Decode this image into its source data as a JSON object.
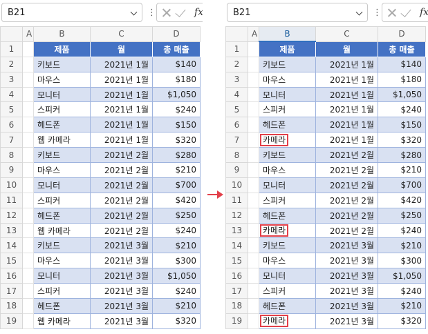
{
  "columns": [
    "",
    "A",
    "B",
    "C",
    "D"
  ],
  "left": {
    "namebox": "B21",
    "header": {
      "b": "제품",
      "c": "월",
      "d": "총 매출"
    },
    "rows": [
      {
        "n": "1"
      },
      {
        "n": "2",
        "b": "키보드",
        "c": "2021년 1월",
        "d": "$140"
      },
      {
        "n": "3",
        "b": "마우스",
        "c": "2021년 1월",
        "d": "$180"
      },
      {
        "n": "4",
        "b": "모니터",
        "c": "2021년 1월",
        "d": "$1,050"
      },
      {
        "n": "5",
        "b": "스피커",
        "c": "2021년 1월",
        "d": "$240"
      },
      {
        "n": "6",
        "b": "헤드폰",
        "c": "2021년 1월",
        "d": "$150"
      },
      {
        "n": "7",
        "b": "웹 카메라",
        "c": "2021년 1월",
        "d": "$320"
      },
      {
        "n": "8",
        "b": "키보드",
        "c": "2021년 2월",
        "d": "$280"
      },
      {
        "n": "9",
        "b": "마우스",
        "c": "2021년 2월",
        "d": "$210"
      },
      {
        "n": "10",
        "b": "모니터",
        "c": "2021년 2월",
        "d": "$700"
      },
      {
        "n": "11",
        "b": "스피커",
        "c": "2021년 2월",
        "d": "$420"
      },
      {
        "n": "12",
        "b": "헤드폰",
        "c": "2021년 2월",
        "d": "$250"
      },
      {
        "n": "13",
        "b": "웹 카메라",
        "c": "2021년 2월",
        "d": "$240"
      },
      {
        "n": "14",
        "b": "키보드",
        "c": "2021년 3월",
        "d": "$210"
      },
      {
        "n": "15",
        "b": "마우스",
        "c": "2021년 3월",
        "d": "$300"
      },
      {
        "n": "16",
        "b": "모니터",
        "c": "2021년 3월",
        "d": "$1,050"
      },
      {
        "n": "17",
        "b": "스피커",
        "c": "2021년 3월",
        "d": "$240"
      },
      {
        "n": "18",
        "b": "헤드폰",
        "c": "2021년 3월",
        "d": "$210"
      },
      {
        "n": "19",
        "b": "웹 카메라",
        "c": "2021년 3월",
        "d": "$320"
      }
    ]
  },
  "right": {
    "namebox": "B21",
    "header": {
      "b": "제품",
      "c": "월",
      "d": "총 매출"
    },
    "rows": [
      {
        "n": "1"
      },
      {
        "n": "2",
        "b": "키보드",
        "c": "2021년 1월",
        "d": "$140"
      },
      {
        "n": "3",
        "b": "마우스",
        "c": "2021년 1월",
        "d": "$180"
      },
      {
        "n": "4",
        "b": "모니터",
        "c": "2021년 1월",
        "d": "$1,050"
      },
      {
        "n": "5",
        "b": "스피커",
        "c": "2021년 1월",
        "d": "$240"
      },
      {
        "n": "6",
        "b": "헤드폰",
        "c": "2021년 1월",
        "d": "$150"
      },
      {
        "n": "7",
        "b": "카메라",
        "c": "2021년 1월",
        "d": "$320"
      },
      {
        "n": "8",
        "b": "키보드",
        "c": "2021년 2월",
        "d": "$280"
      },
      {
        "n": "9",
        "b": "마우스",
        "c": "2021년 2월",
        "d": "$210"
      },
      {
        "n": "10",
        "b": "모니터",
        "c": "2021년 2월",
        "d": "$700"
      },
      {
        "n": "11",
        "b": "스피커",
        "c": "2021년 2월",
        "d": "$420"
      },
      {
        "n": "12",
        "b": "헤드폰",
        "c": "2021년 2월",
        "d": "$250"
      },
      {
        "n": "13",
        "b": "카메라",
        "c": "2021년 2월",
        "d": "$240"
      },
      {
        "n": "14",
        "b": "키보드",
        "c": "2021년 3월",
        "d": "$210"
      },
      {
        "n": "15",
        "b": "마우스",
        "c": "2021년 3월",
        "d": "$300"
      },
      {
        "n": "16",
        "b": "모니터",
        "c": "2021년 3월",
        "d": "$1,050"
      },
      {
        "n": "17",
        "b": "스피커",
        "c": "2021년 3월",
        "d": "$240"
      },
      {
        "n": "18",
        "b": "헤드폰",
        "c": "2021년 3월",
        "d": "$210"
      },
      {
        "n": "19",
        "b": "카메라",
        "c": "2021년 3월",
        "d": "$320"
      }
    ]
  },
  "icons": {
    "cancel": "x-icon",
    "enter": "check-icon",
    "function": "fx-icon",
    "dropdown": "chevron-down-icon",
    "more": "kebab-icon",
    "transition": "arrow-right-icon"
  },
  "fx_symbol": "fx",
  "kebab_symbol": "⋮",
  "colors": {
    "header_fill": "#4472c4",
    "band_fill": "#d9e1f2",
    "highlight_border": "#e2404a",
    "arrow": "#e2404a"
  }
}
